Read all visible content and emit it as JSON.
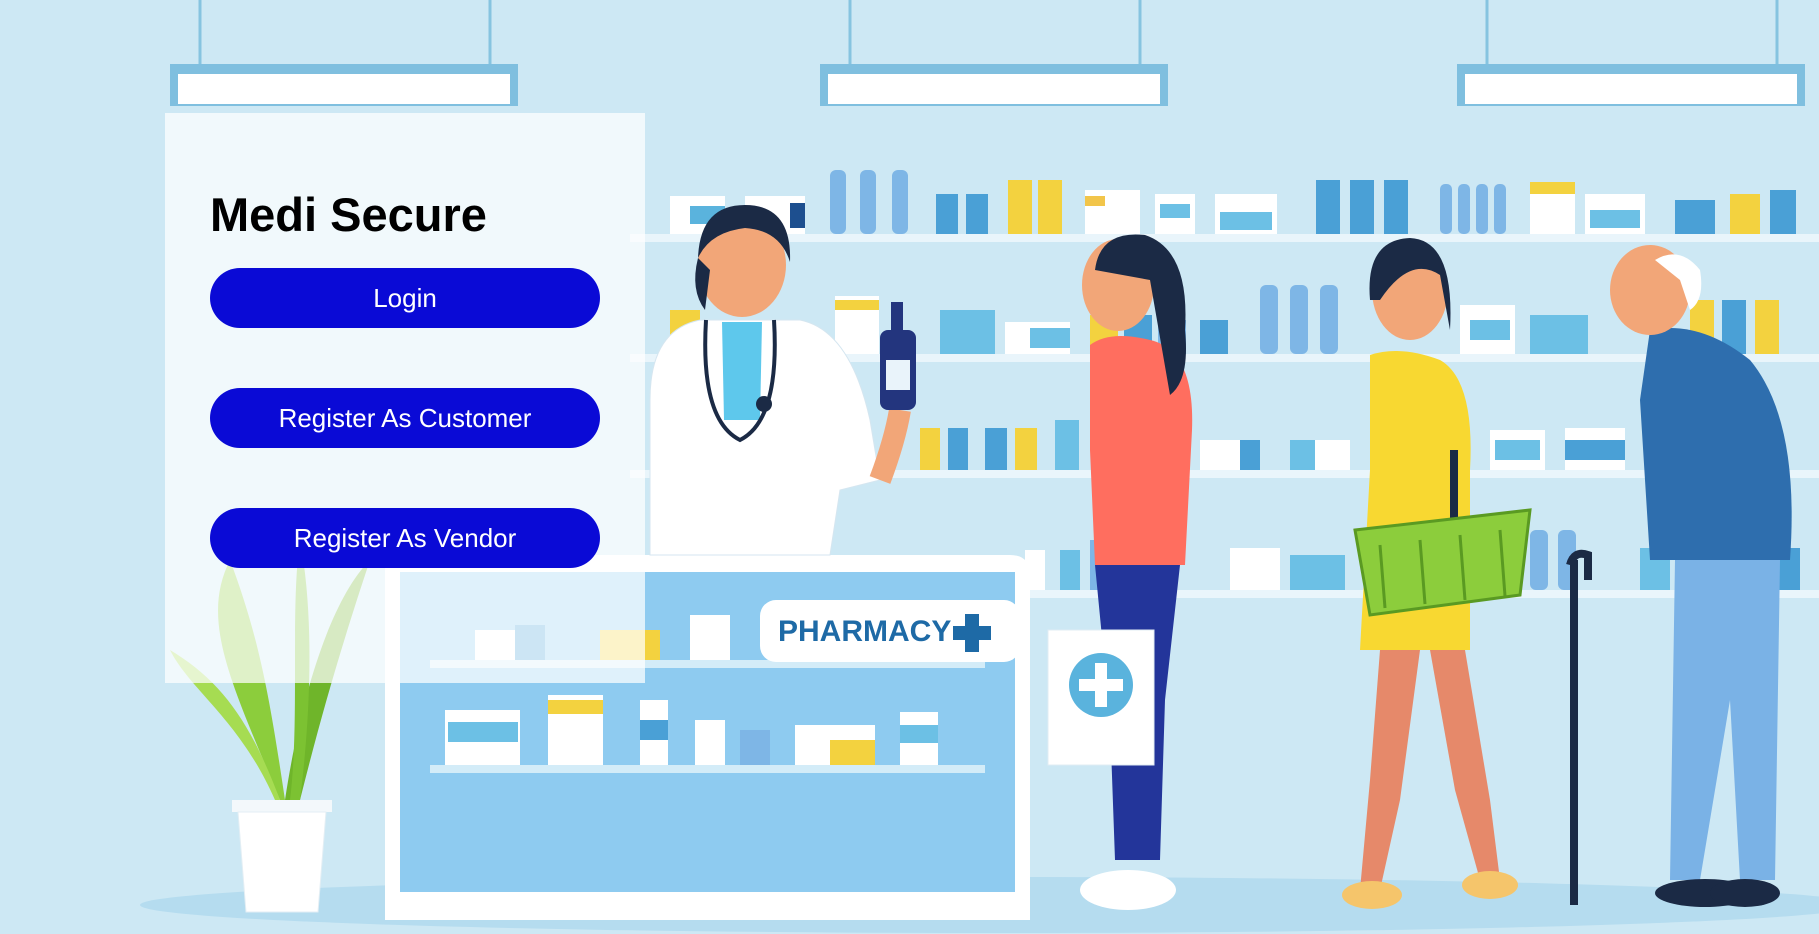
{
  "app": {
    "title": "Medi Secure"
  },
  "actions": {
    "login_label": "Login",
    "register_customer_label": "Register As Customer",
    "register_vendor_label": "Register As Vendor"
  },
  "illustration": {
    "sign_text": "PHARMACY",
    "sign_icon": "plus-icon"
  },
  "colors": {
    "button_bg": "#0a0ad6",
    "button_text": "#ffffff",
    "background": "#cde8f4"
  }
}
